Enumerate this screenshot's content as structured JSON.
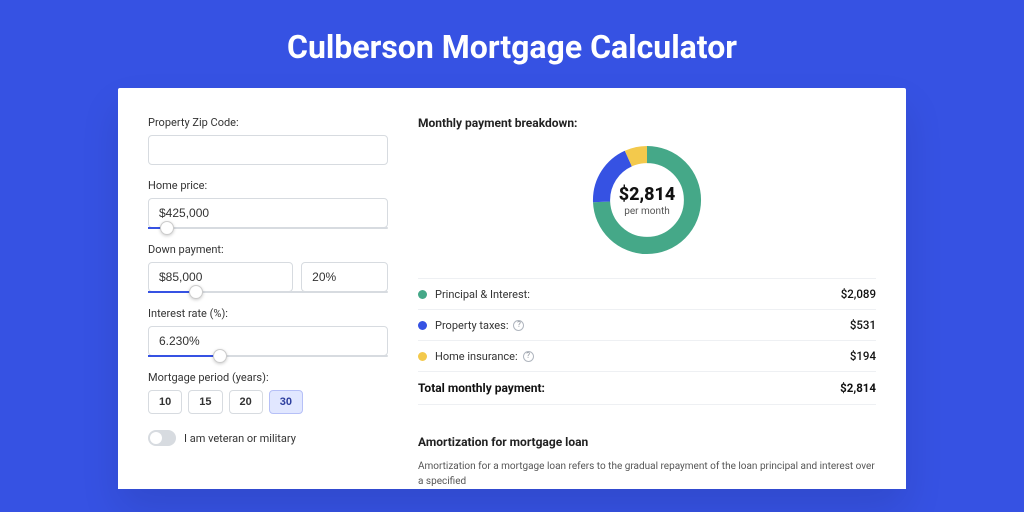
{
  "page_title": "Culberson Mortgage Calculator",
  "colors": {
    "principal": "#45a888",
    "taxes": "#3652e3",
    "insurance": "#f3c94c"
  },
  "form": {
    "zip": {
      "label": "Property Zip Code:",
      "value": ""
    },
    "home_price": {
      "label": "Home price:",
      "value": "$425,000",
      "slider_pct": 8
    },
    "down_payment": {
      "label": "Down payment:",
      "amount": "$85,000",
      "percent": "20%",
      "slider_pct": 20
    },
    "interest": {
      "label": "Interest rate (%):",
      "value": "6.230%",
      "slider_pct": 30
    },
    "period": {
      "label": "Mortgage period (years):",
      "options": [
        "10",
        "15",
        "20",
        "30"
      ],
      "selected": "30"
    },
    "veteran": {
      "label": "I am veteran or military",
      "checked": false
    }
  },
  "breakdown": {
    "title": "Monthly payment breakdown:",
    "donut": {
      "amount": "$2,814",
      "sub": "per month"
    },
    "items": [
      {
        "label": "Principal & Interest:",
        "value": "$2,089",
        "color_key": "principal",
        "has_info": false
      },
      {
        "label": "Property taxes:",
        "value": "$531",
        "color_key": "taxes",
        "has_info": true
      },
      {
        "label": "Home insurance:",
        "value": "$194",
        "color_key": "insurance",
        "has_info": true
      }
    ],
    "total": {
      "label": "Total monthly payment:",
      "value": "$2,814"
    }
  },
  "amortization": {
    "title": "Amortization for mortgage loan",
    "body": "Amortization for a mortgage loan refers to the gradual repayment of the loan principal and interest over a specified"
  },
  "chart_data": {
    "type": "pie",
    "title": "Monthly payment breakdown",
    "categories": [
      "Principal & Interest",
      "Property taxes",
      "Home insurance"
    ],
    "values": [
      2089,
      531,
      194
    ],
    "total": 2814
  }
}
